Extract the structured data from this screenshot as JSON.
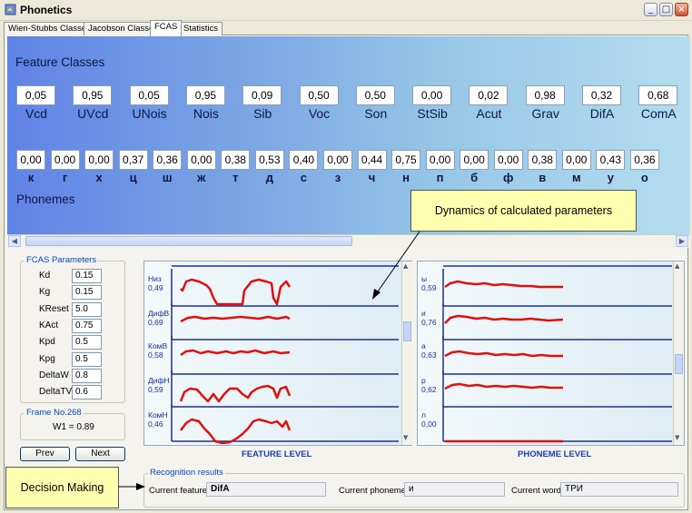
{
  "window": {
    "title": "Phonetics"
  },
  "tabs": [
    {
      "label": "Wien-Stubbs Classes"
    },
    {
      "label": "Jacobson Classes"
    },
    {
      "label": "FCAS",
      "active": true
    },
    {
      "label": "Statistics"
    }
  ],
  "feature_panel": {
    "heading": "Feature Classes",
    "features": [
      {
        "value": "0,05",
        "label": "Vcd"
      },
      {
        "value": "0,95",
        "label": "UVcd"
      },
      {
        "value": "0,05",
        "label": "UNois"
      },
      {
        "value": "0,95",
        "label": "Nois"
      },
      {
        "value": "0,09",
        "label": "Sib"
      },
      {
        "value": "0,50",
        "label": "Voc"
      },
      {
        "value": "0,50",
        "label": "Son"
      },
      {
        "value": "0,00",
        "label": "StSib"
      },
      {
        "value": "0,02",
        "label": "Acut"
      },
      {
        "value": "0,98",
        "label": "Grav"
      },
      {
        "value": "0,32",
        "label": "DifA"
      },
      {
        "value": "0,68",
        "label": "ComA"
      }
    ],
    "phonemes": [
      {
        "value": "0,00",
        "label": "к"
      },
      {
        "value": "0,00",
        "label": "г"
      },
      {
        "value": "0,00",
        "label": "х"
      },
      {
        "value": "0,37",
        "label": "ц"
      },
      {
        "value": "0,36",
        "label": "ш"
      },
      {
        "value": "0,00",
        "label": "ж"
      },
      {
        "value": "0,38",
        "label": "т"
      },
      {
        "value": "0,53",
        "label": "д"
      },
      {
        "value": "0,40",
        "label": "с"
      },
      {
        "value": "0,00",
        "label": "з"
      },
      {
        "value": "0,44",
        "label": "ч"
      },
      {
        "value": "0,75",
        "label": "н"
      },
      {
        "value": "0,00",
        "label": "п"
      },
      {
        "value": "0,00",
        "label": "б"
      },
      {
        "value": "0,00",
        "label": "ф"
      },
      {
        "value": "0,38",
        "label": "в"
      },
      {
        "value": "0,00",
        "label": "м"
      },
      {
        "value": "0,43",
        "label": "у"
      },
      {
        "value": "0,36",
        "label": "о"
      }
    ],
    "phonemes_heading": "Phonemes"
  },
  "fcas_params": {
    "title": "FCAS Parameters",
    "params": [
      {
        "label": "Kd",
        "value": "0.15"
      },
      {
        "label": "Kg",
        "value": "0.15"
      },
      {
        "label": "KReset",
        "value": "5.0"
      },
      {
        "label": "KAct",
        "value": "0.75"
      },
      {
        "label": "Kpd",
        "value": "0.5"
      },
      {
        "label": "Kpg",
        "value": "0.5"
      },
      {
        "label": "DeltaW",
        "value": "0.8"
      },
      {
        "label": "DeltaTV",
        "value": "0.6"
      }
    ]
  },
  "frame": {
    "title": "Frame No.268",
    "w1": "W1 = 0.89"
  },
  "buttons": {
    "prev": "Prev",
    "next": "Next"
  },
  "feature_level": {
    "title": "FEATURE LEVEL",
    "tracks": [
      {
        "name": "Низ",
        "value": "0,49"
      },
      {
        "name": "ДифВ",
        "value": "0,69"
      },
      {
        "name": "КомВ",
        "value": "0,58"
      },
      {
        "name": "ДифН",
        "value": "0,59"
      },
      {
        "name": "КомН",
        "value": "0,46"
      }
    ]
  },
  "phoneme_level": {
    "title": "PHONEME LEVEL",
    "tracks": [
      {
        "name": "ы",
        "value": "0,59"
      },
      {
        "name": "и",
        "value": "0,76"
      },
      {
        "name": "а",
        "value": "0,63"
      },
      {
        "name": "р",
        "value": "0,62"
      },
      {
        "name": "л",
        "value": "0,00"
      }
    ]
  },
  "recognition": {
    "title": "Recognition results",
    "feature_label": "Current feature:",
    "feature_value": "DifA",
    "phoneme_label": "Current phoneme:",
    "phoneme_value": "и",
    "word_label": "Current word:",
    "word_value": "ТРИ"
  },
  "annotations": {
    "dynamics": "Dynamics of calculated parameters",
    "decision": "Decision Making"
  },
  "colors": {
    "trace": "#e01010",
    "axis": "#1a2f9a",
    "panel_start": "#5f83e6",
    "panel_end": "#b4ddee"
  }
}
